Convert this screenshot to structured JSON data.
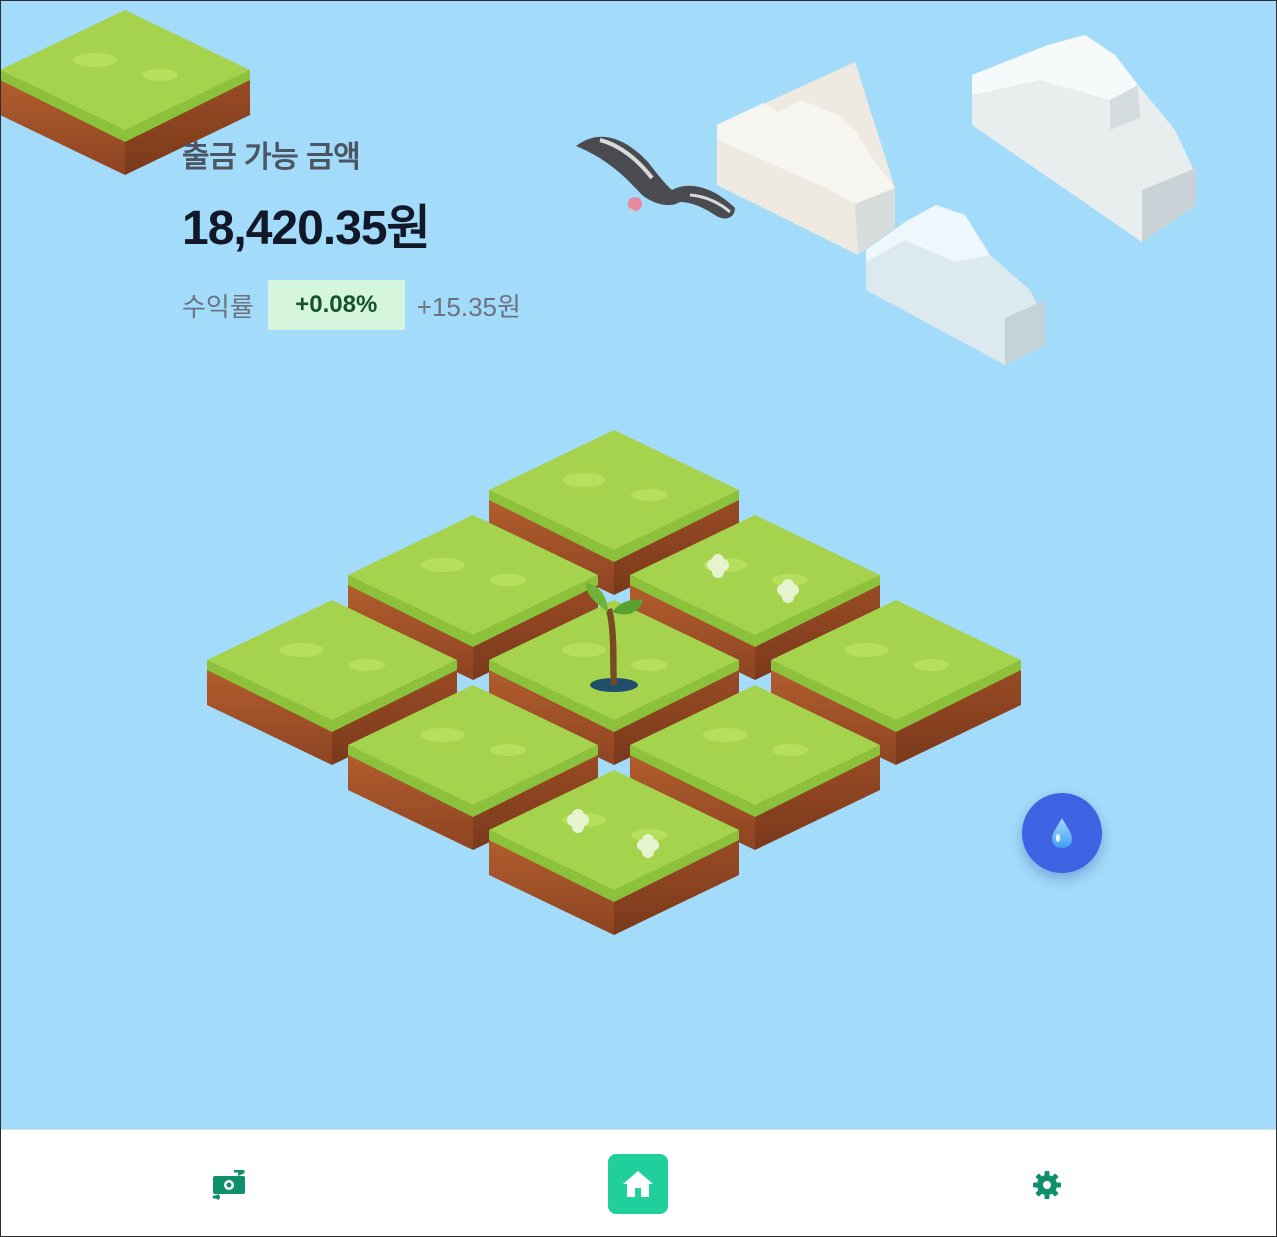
{
  "balance": {
    "label": "출금 가능 금액",
    "amount": "18,420.35원",
    "rate_label": "수익률",
    "rate_percent": "+0.08%",
    "rate_amount": "+15.35원"
  },
  "colors": {
    "sky": "#a3dcfb",
    "grass": "#a6d34d",
    "dirt": "#a55228",
    "water_button": "#3f63e3",
    "nav_active": "#20d09c",
    "nav_icon": "#0f8f6c",
    "rate_badge_bg": "#d6f5dd"
  },
  "garden": {
    "tiles": 9,
    "plant": "sprout"
  },
  "icons": {
    "water": "water-drop-icon",
    "exchange": "money-exchange-icon",
    "home": "home-icon",
    "settings": "gear-icon"
  },
  "nav": {
    "items": [
      {
        "name": "exchange",
        "active": false
      },
      {
        "name": "home",
        "active": true
      },
      {
        "name": "settings",
        "active": false
      }
    ]
  }
}
